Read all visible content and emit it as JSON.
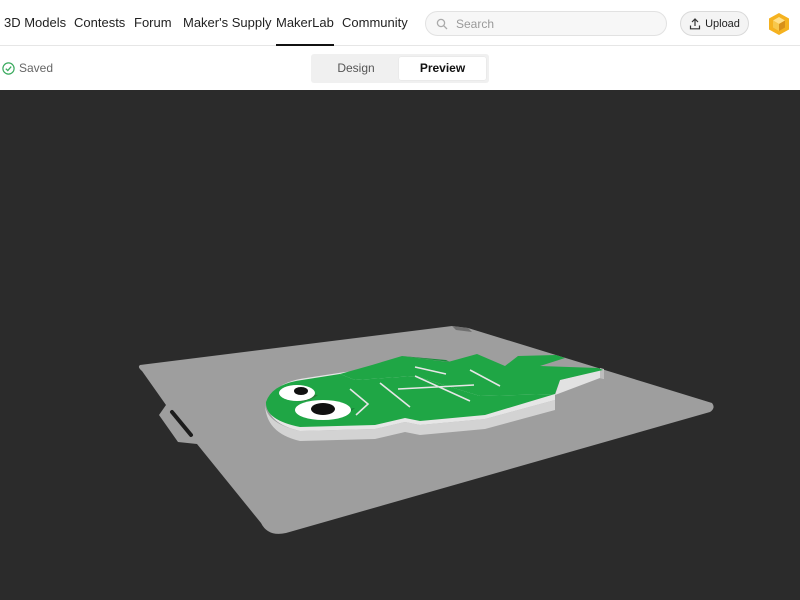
{
  "nav": {
    "items": [
      {
        "label": "3D Models"
      },
      {
        "label": "Contests"
      },
      {
        "label": "Forum"
      },
      {
        "label": "Maker's Supply"
      },
      {
        "label": "MakerLab",
        "active": true
      },
      {
        "label": "Community"
      }
    ],
    "search_placeholder": "Search",
    "upload_label": "Upload",
    "logo_icon": "hexagon-logo-icon"
  },
  "toolbar": {
    "saved_label": "Saved",
    "tabs": [
      "Design",
      "Preview"
    ],
    "active_tab": "Preview"
  },
  "colors": {
    "viewport_bg": "#2b2b2b",
    "plate": "#9e9e9e",
    "model_green": "#1fa645",
    "model_base": "#dedede",
    "saved_green": "#3aaa5e"
  }
}
